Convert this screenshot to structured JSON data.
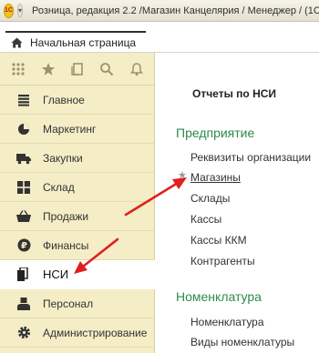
{
  "window": {
    "app_icon": "1C",
    "title": "Розница, редакция 2.2 /Магазин Канцелярия / Менеджер /  (1С:"
  },
  "tabs": {
    "home_label": "Начальная страница"
  },
  "toolbar": {
    "icons": [
      "apps-grid-icon",
      "star-icon",
      "history-icon",
      "search-icon",
      "bell-icon"
    ]
  },
  "sidebar": {
    "items": [
      {
        "label": "Главное",
        "icon": "menu-list-icon",
        "active": false
      },
      {
        "label": "Маркетинг",
        "icon": "pie-chart-icon",
        "active": false
      },
      {
        "label": "Закупки",
        "icon": "truck-icon",
        "active": false
      },
      {
        "label": "Склад",
        "icon": "warehouse-grid-icon",
        "active": false
      },
      {
        "label": "Продажи",
        "icon": "basket-icon",
        "active": false
      },
      {
        "label": "Финансы",
        "icon": "ruble-coin-icon",
        "active": false
      },
      {
        "label": "НСИ",
        "icon": "books-icon",
        "active": true
      },
      {
        "label": "Персонал",
        "icon": "person-icon",
        "active": false
      },
      {
        "label": "Администрирование",
        "icon": "gear-icon",
        "active": false
      }
    ]
  },
  "content": {
    "title": "Отчеты по НСИ",
    "group1": {
      "title": "Предприятие",
      "links": [
        "Реквизиты организации",
        "Магазины",
        "Склады",
        "Кассы",
        "Кассы ККМ",
        "Контрагенты"
      ]
    },
    "group2": {
      "title": "Номенклатура",
      "links": [
        "Номенклатура",
        "Виды номенклатуры"
      ]
    }
  },
  "colors": {
    "sidebar_bg": "#f4edc6",
    "group_title": "#2e8b47",
    "arrow": "#e02020"
  }
}
